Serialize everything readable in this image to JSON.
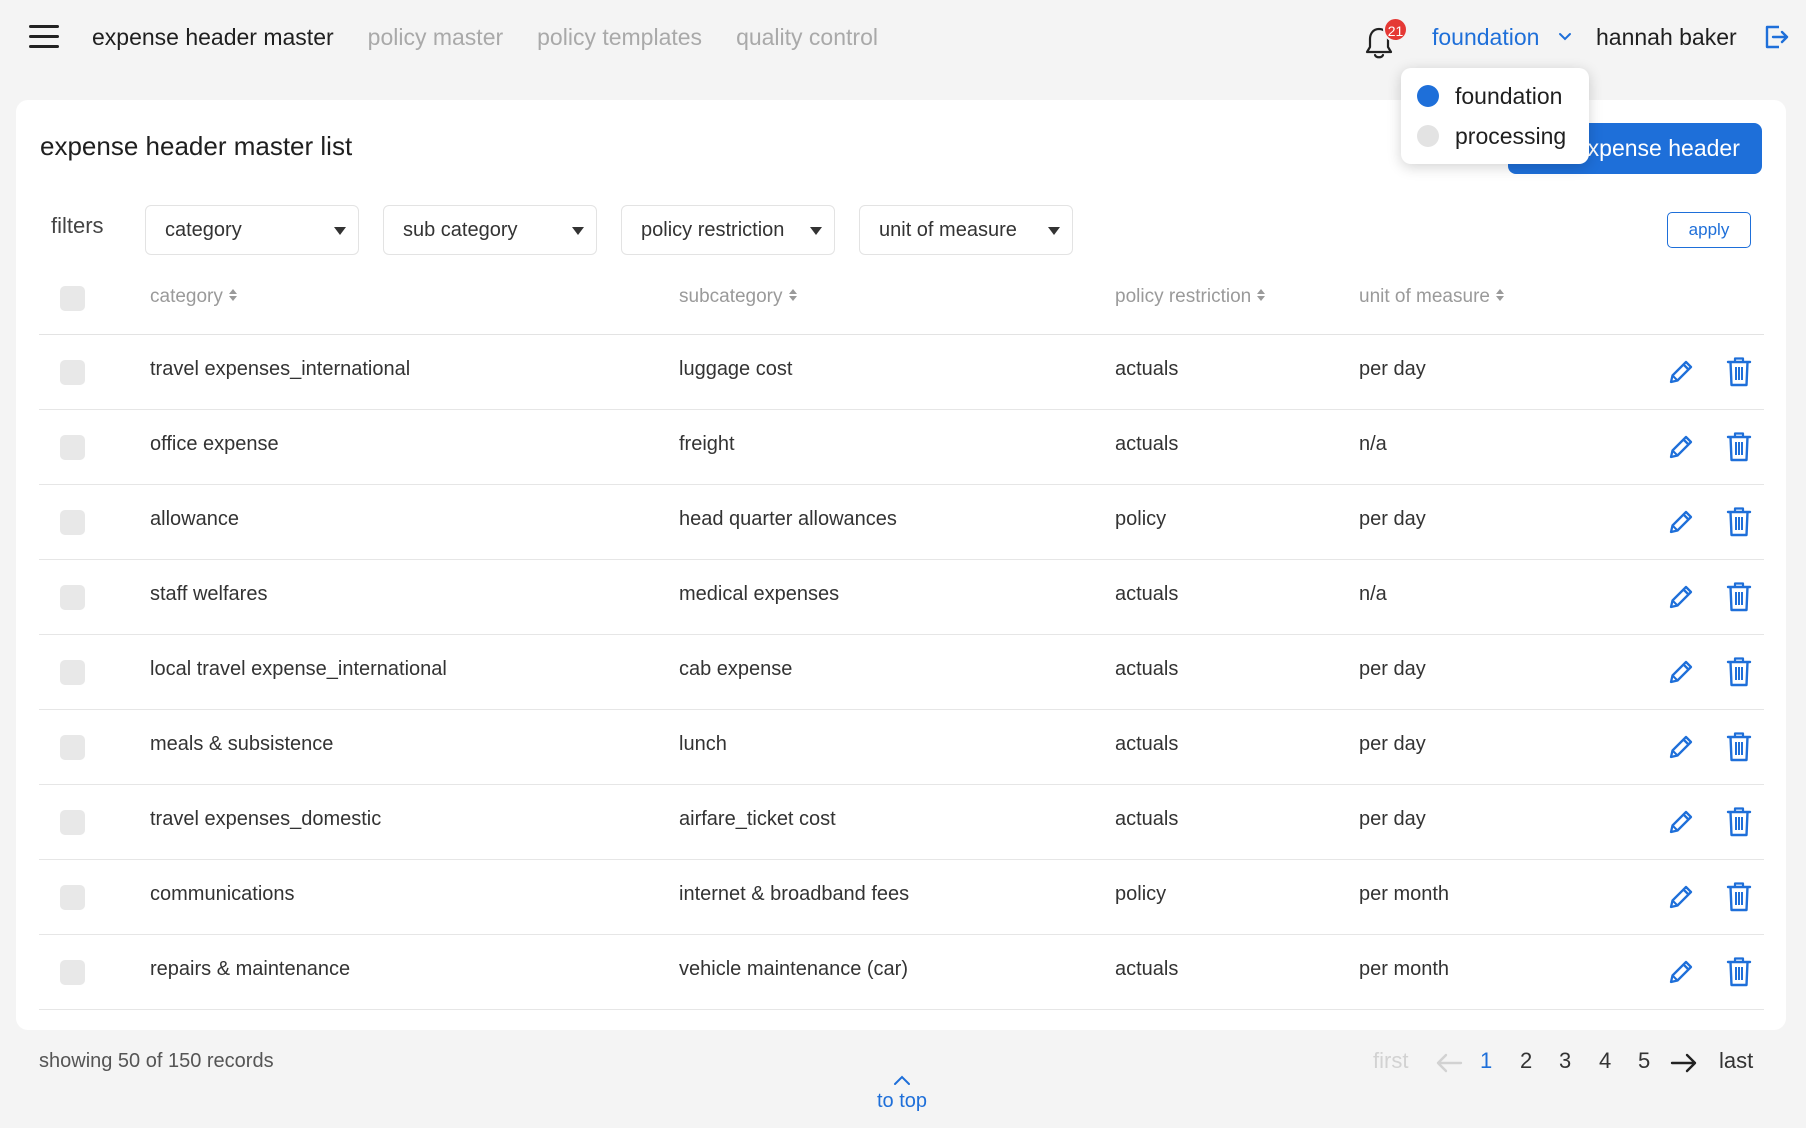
{
  "nav": {
    "tabs": [
      {
        "label": "expense header master"
      },
      {
        "label": "policy master"
      },
      {
        "label": "policy templates"
      },
      {
        "label": "quality control"
      }
    ],
    "notification_count": "21",
    "workspace": "foundation",
    "user": "hannah baker",
    "workspace_menu": [
      {
        "label": "foundation",
        "color": "#1e6fd9"
      },
      {
        "label": "processing",
        "color": "#e3e3e3"
      }
    ]
  },
  "card": {
    "title": "expense header master list",
    "add_button": "add expense header"
  },
  "filters": {
    "label": "filters",
    "items": [
      "category",
      "sub category",
      "policy restriction",
      "unit of measure"
    ],
    "apply": "apply"
  },
  "table": {
    "headers": [
      "category",
      "subcategory",
      "policy restriction",
      "unit of measure"
    ],
    "rows": [
      [
        "travel expenses_international",
        "luggage cost",
        "actuals",
        "per day"
      ],
      [
        "office expense",
        "freight",
        "actuals",
        "n/a"
      ],
      [
        "allowance",
        "head quarter allowances",
        "policy",
        "per day"
      ],
      [
        "staff welfares",
        "medical expenses",
        "actuals",
        "n/a"
      ],
      [
        "local travel expense_international",
        "cab expense",
        "actuals",
        "per day"
      ],
      [
        "meals & subsistence",
        "lunch",
        "actuals",
        "per day"
      ],
      [
        "travel expenses_domestic",
        "airfare_ticket cost",
        "actuals",
        "per day"
      ],
      [
        "communications",
        "internet & broadband fees",
        "policy",
        "per month"
      ],
      [
        "repairs & maintenance",
        "vehicle maintenance (car)",
        "actuals",
        "per month"
      ]
    ]
  },
  "footer": {
    "records": "showing 50 of 150 records",
    "first": "first",
    "pages": [
      "1",
      "2",
      "3",
      "4",
      "5"
    ],
    "current_page": "1",
    "last": "last",
    "to_top": "to top"
  },
  "colors": {
    "accent": "#1e6fd9",
    "badge": "#e53935"
  }
}
